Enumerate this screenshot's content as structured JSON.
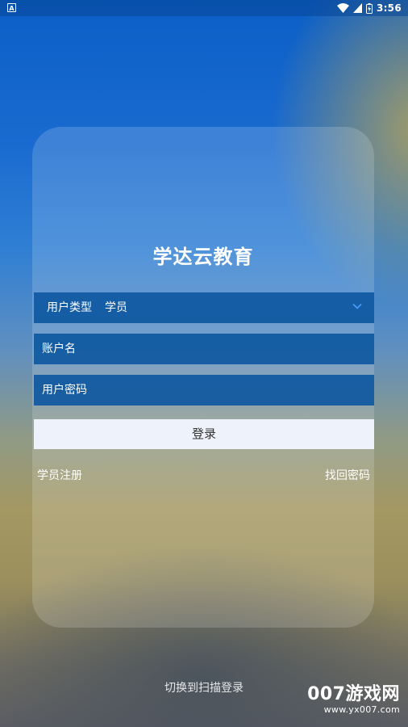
{
  "status_bar": {
    "left_icon_letter": "A",
    "time": "3:56",
    "icons": [
      "wifi-icon",
      "signal-icon",
      "battery-icon"
    ]
  },
  "login": {
    "app_title": "学达云教育",
    "user_type_label": "用户类型",
    "user_type_value": "学员",
    "username_placeholder": "账户名",
    "password_placeholder": "用户密码",
    "login_button": "登录",
    "register_link": "学员注册",
    "forgot_link": "找回密码",
    "switch_scan": "切换到扫描登录"
  },
  "watermark": {
    "brand": "007游戏网",
    "url": "www.yx007.com"
  },
  "colors": {
    "field_bg": "#0e58a0",
    "button_bg": "#eef2fa",
    "chevron": "#4a9eff",
    "text_light": "#ffffff"
  }
}
